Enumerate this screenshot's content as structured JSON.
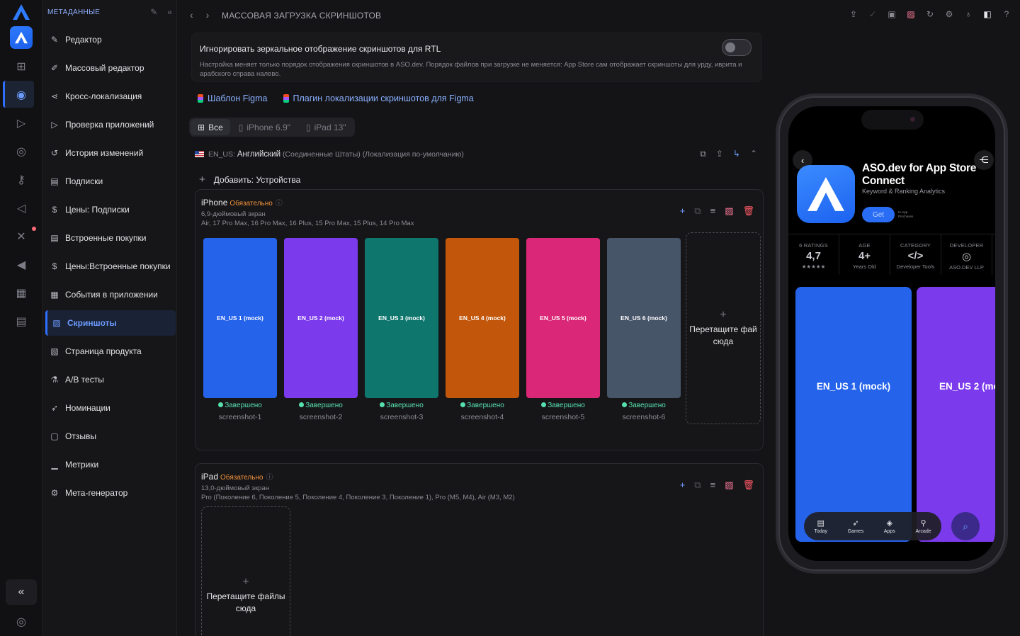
{
  "rail": {
    "icons": [
      "logo-icon",
      "app-icon",
      "grid-icon",
      "apple-icon",
      "play-icon",
      "eye-icon",
      "key-icon",
      "megaphone-icon",
      "tools-icon",
      "speaker-icon",
      "chart-icon",
      "store-icon"
    ]
  },
  "sidebar": {
    "header": "МЕТАДАННЫЕ",
    "items": [
      {
        "label": "Редактор",
        "icon": "pencil-icon"
      },
      {
        "label": "Массовый редактор",
        "icon": "edit-icon"
      },
      {
        "label": "Кросс-локализация",
        "icon": "share-icon"
      },
      {
        "label": "Проверка приложений",
        "icon": "play-icon"
      },
      {
        "label": "История изменений",
        "icon": "history-icon"
      },
      {
        "label": "Подписки",
        "icon": "document-icon"
      },
      {
        "label": "Цены: Подписки",
        "icon": "dollar-icon"
      },
      {
        "label": "Встроенные покупки",
        "icon": "document-icon"
      },
      {
        "label": "Цены:Встроенные покупки",
        "icon": "dollar-icon"
      },
      {
        "label": "События в приложении",
        "icon": "calendar-icon"
      },
      {
        "label": "Скриншоты",
        "icon": "image-icon"
      },
      {
        "label": "Страница продукта",
        "icon": "images-icon"
      },
      {
        "label": "A/B тесты",
        "icon": "flask-icon"
      },
      {
        "label": "Номинации",
        "icon": "rocket-icon"
      },
      {
        "label": "Отзывы",
        "icon": "review-icon"
      },
      {
        "label": "Метрики",
        "icon": "chart-icon"
      },
      {
        "label": "Мета-генератор",
        "icon": "gear-icon"
      }
    ]
  },
  "topbar": {
    "title": "МАССОВАЯ ЗАГРУЗКА СКРИНШОТОВ"
  },
  "rtl": {
    "title": "Игнорировать зеркальное отображение скриншотов для RTL",
    "description": "Настройка меняет только порядок отображения скриншотов в ASO.dev. Порядок файлов при загрузке не меняется: App Store сам отображает скриншоты для урду, иврита и арабского справа налево."
  },
  "figma": {
    "template": "Шаблон Figma",
    "plugin": "Плагин локализации скриншотов для Figma"
  },
  "filters": {
    "all": "Все",
    "iphone": "iPhone 6.9\"",
    "ipad": "iPad 13\""
  },
  "locale": {
    "code": "EN_US:",
    "name": "Английский",
    "note": "(Соединенные Штаты) (Локализация по-умолчанию)"
  },
  "add_devices": "Добавить: Устройства",
  "iphone_card": {
    "title": "iPhone",
    "required": "Обязательно",
    "size": "6,9-дюймовый экран",
    "models": "Air, 17 Pro Max, 16 Pro Max, 16 Plus, 15 Pro Max, 15 Plus, 14 Pro Max",
    "drop_text": "Перетащите фай сюда",
    "screenshots": [
      {
        "label": "EN_US 1 (mock)",
        "status": "Завершено",
        "file": "screenshot-1",
        "color": "#2563eb"
      },
      {
        "label": "EN_US 2 (mock)",
        "status": "Завершено",
        "file": "screenshot-2",
        "color": "#7c3aed"
      },
      {
        "label": "EN_US 3 (mock)",
        "status": "Завершено",
        "file": "screenshot-3",
        "color": "#0f766e"
      },
      {
        "label": "EN_US 4 (mock)",
        "status": "Завершено",
        "file": "screenshot-4",
        "color": "#c2570c"
      },
      {
        "label": "EN_US 5 (mock)",
        "status": "Завершено",
        "file": "screenshot-5",
        "color": "#db2777"
      },
      {
        "label": "EN_US 6 (mock)",
        "status": "Завершено",
        "file": "screenshot-6",
        "color": "#475569"
      }
    ]
  },
  "ipad_card": {
    "title": "iPad",
    "required": "Обязательно",
    "size": "13,0-дюймовый экран",
    "models": "Pro (Поколение 6, Поколение 5, Поколение 4, Поколение 3, Поколение 1), Pro (M5, M4), Air (M3, M2)",
    "drop_text": "Перетащите файлы сюда"
  },
  "preview": {
    "app_name": "ASO.dev for App Store Connect",
    "subtitle": "Keyword & Ranking Analytics",
    "get": "Get",
    "iap": "In-App Purchases",
    "stats": [
      {
        "k": "6 RATINGS",
        "v": "4,7",
        "s": "★★★★★"
      },
      {
        "k": "AGE",
        "v": "4+",
        "s": "Years Old"
      },
      {
        "k": "CATEGORY",
        "v": "</>",
        "s": "Developer Tools"
      },
      {
        "k": "DEVELOPER",
        "v": "◎",
        "s": "ASO.DEV LLP"
      }
    ],
    "shot1": "EN_US 1 (mock)",
    "shot2": "EN_US 2 (mo",
    "tabs": [
      {
        "label": "Today",
        "icon": "today-icon"
      },
      {
        "label": "Games",
        "icon": "rocket-icon"
      },
      {
        "label": "Apps",
        "icon": "stack-icon"
      },
      {
        "label": "Arcade",
        "icon": "joystick-icon"
      }
    ]
  }
}
